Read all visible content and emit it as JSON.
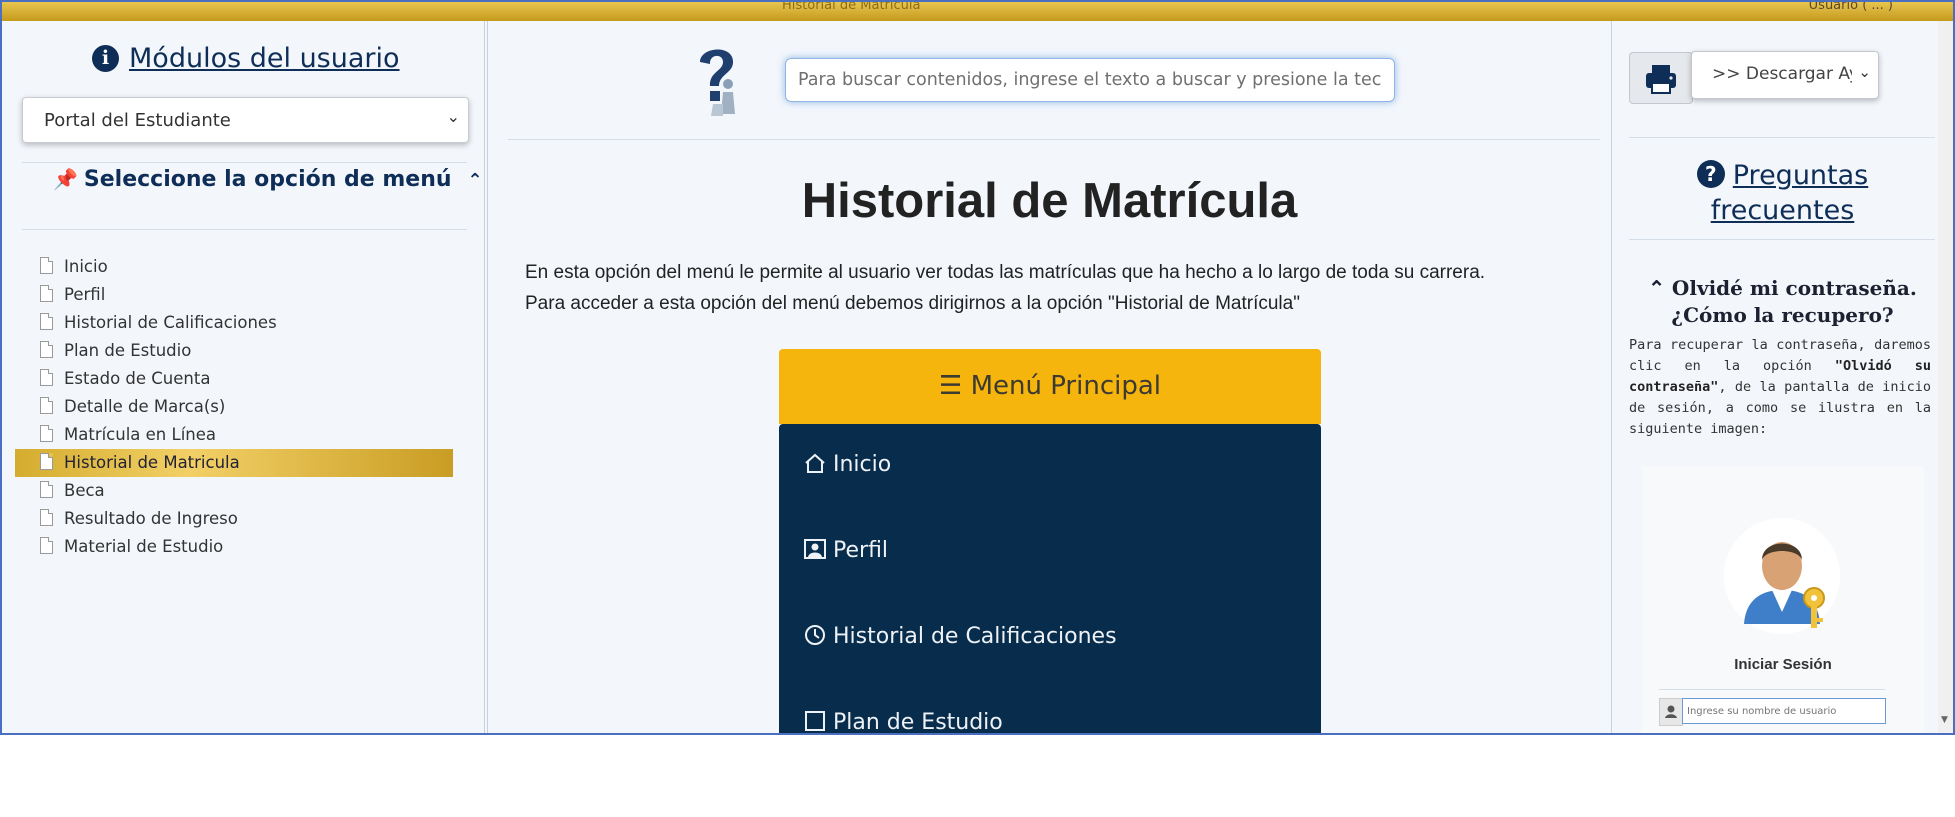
{
  "topbar": {
    "center_text": "Historial de Matrícula",
    "right_text": "Usuario ( ... )"
  },
  "left": {
    "modules_title": "Módulos del usuario",
    "module_select_value": "Portal del Estudiante",
    "menu_title": "Seleccione la opción de menú",
    "menu_items": [
      "Inicio",
      "Perfil",
      "Historial de Calificaciones",
      "Plan de Estudio",
      "Estado de Cuenta",
      "Detalle de Marca(s)",
      "Matrícula en Línea",
      "Historial de Matricula",
      "Beca",
      "Resultado de Ingreso",
      "Material de Estudio"
    ],
    "active_index": 7
  },
  "middle": {
    "search_placeholder": "Para buscar contenidos, ingrese el texto a buscar y presione la tecla E",
    "page_title": "Historial de Matrícula",
    "desc_line1": "En esta opción del menú le permite al usuario ver todas las matrículas que ha hecho a lo largo de toda su carrera.",
    "desc_line2": "Para acceder a esta opción del menú debemos dirigirnos a la opción \"Historial de Matrícula\"",
    "preview": {
      "header": "Menú Principal",
      "items": [
        "Inicio",
        "Perfil",
        "Historial de Calificaciones",
        "Plan de Estudio"
      ]
    }
  },
  "right": {
    "download_select": ">> Descargar Ayuda",
    "faq_title_line1": "Preguntas",
    "faq_title_line2": "frecuentes",
    "q_title_line1": "Olvidé mi contraseña.",
    "q_title_line2": "¿Cómo la recupero?",
    "q_body_pre": "Para recuperar la contraseña, daremos clic en la opción ",
    "q_body_bold": "\"Olvidó su contraseña\"",
    "q_body_post": ", de la pantalla de inicio de sesión, a como se ilustra en la siguiente imagen:",
    "login_label": "Iniciar Sesión",
    "user_placeholder": "Ingrese su nombre de usuario"
  },
  "colors": {
    "navy": "#0e2e57",
    "gold": "#f6b50c",
    "panel_dark": "#082d4c"
  }
}
